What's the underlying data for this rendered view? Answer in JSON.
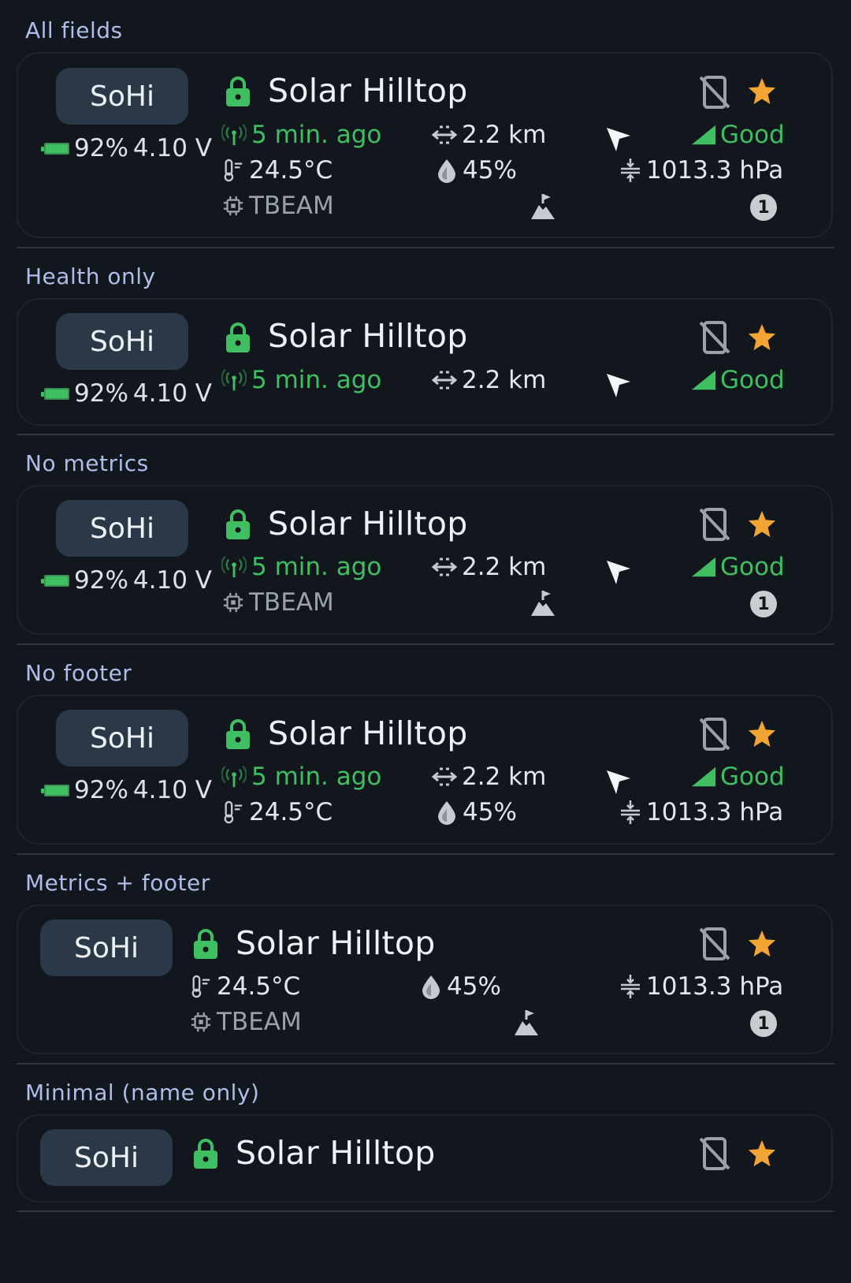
{
  "node": {
    "short_name": "SoHi",
    "long_name": "Solar Hilltop",
    "battery_percent": "92%",
    "voltage": "4.10 V",
    "last_heard": "5 min. ago",
    "distance": "2.2 km",
    "signal": "Good",
    "temperature": "24.5°C",
    "humidity": "45%",
    "pressure": "1013.3 hPa",
    "hardware": "TBEAM",
    "hops": "1"
  },
  "sections": [
    {
      "title": "All fields"
    },
    {
      "title": "Health only"
    },
    {
      "title": "No metrics"
    },
    {
      "title": "No footer"
    },
    {
      "title": "Metrics + footer"
    },
    {
      "title": "Minimal (name only)"
    }
  ],
  "colors": {
    "background": "#12161d",
    "chip": "#2a3848",
    "green": "#3fbf62",
    "star": "#f3a533",
    "section_title": "#aebde9"
  },
  "icons": [
    "lock-icon",
    "no-phone-icon",
    "star-icon",
    "antenna-icon",
    "distance-icon",
    "direction-arrow-icon",
    "signal-icon",
    "thermometer-icon",
    "humidity-drop-icon",
    "pressure-icon",
    "chip-icon",
    "elevation-icon",
    "hops-badge-icon",
    "battery-icon"
  ]
}
